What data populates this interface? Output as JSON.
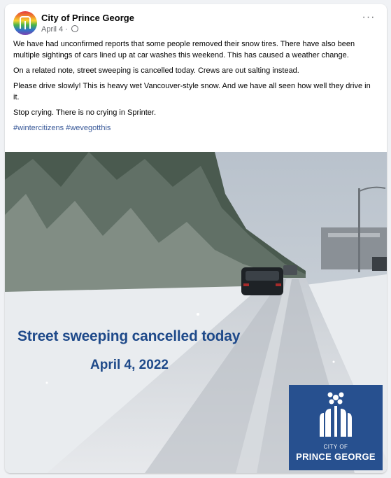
{
  "post": {
    "page_name": "City of Prince George",
    "date": "April 4",
    "separator": " · ",
    "more_icon": "···",
    "paragraphs": [
      "We have had unconfirmed reports that some people removed their snow tires. There have also been multiple sightings of cars lined up at car washes this weekend. This has caused a weather change.",
      "On a related note, street sweeping is cancelled today. Crews are out salting instead.",
      "Please drive slowly! This is heavy wet Vancouver-style snow. And we have all seen how well they drive in it.",
      "Stop crying. There is no crying in Sprinter."
    ],
    "hashtags": [
      "#wintercitizens",
      "#wevegotthis"
    ]
  },
  "image": {
    "headline": "Street sweeping cancelled today",
    "subhead": "April 4, 2022",
    "logo_line1": "CITY OF",
    "logo_line2": "PRINCE GEORGE"
  },
  "icons": {
    "avatar": "city-logo-rainbow",
    "privacy": "globe-icon",
    "more": "more-options-icon"
  },
  "colors": {
    "link": "#385898",
    "headline": "#1f4a8a",
    "logo_bg": "#27508f"
  }
}
